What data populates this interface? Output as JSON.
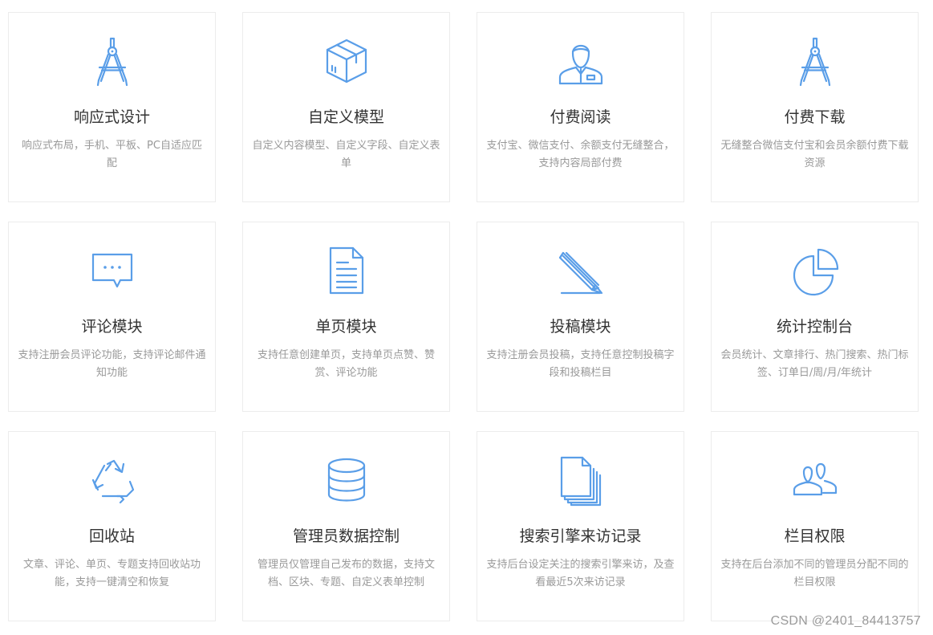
{
  "features": [
    {
      "icon": "compass-icon",
      "title": "响应式设计",
      "desc": "响应式布局，手机、平板、PC自适应匹配"
    },
    {
      "icon": "box-icon",
      "title": "自定义模型",
      "desc": "自定义内容模型、自定义字段、自定义表单"
    },
    {
      "icon": "user-icon",
      "title": "付费阅读",
      "desc": "支付宝、微信支付、余额支付无缝整合，支持内容局部付费"
    },
    {
      "icon": "compass-icon",
      "title": "付费下载",
      "desc": "无缝整合微信支付宝和会员余额付费下载资源"
    },
    {
      "icon": "comment-icon",
      "title": "评论模块",
      "desc": "支持注册会员评论功能，支持评论邮件通知功能"
    },
    {
      "icon": "document-icon",
      "title": "单页模块",
      "desc": "支持任意创建单页，支持单页点赞、赞赏、评论功能"
    },
    {
      "icon": "pencil-icon",
      "title": "投稿模块",
      "desc": "支持注册会员投稿，支持任意控制投稿字段和投稿栏目"
    },
    {
      "icon": "pie-chart-icon",
      "title": "统计控制台",
      "desc": "会员统计、文章排行、热门搜索、热门标签、订单日/周/月/年统计"
    },
    {
      "icon": "recycle-icon",
      "title": "回收站",
      "desc": "文章、评论、单页、专题支持回收站功能，支持一键清空和恢复"
    },
    {
      "icon": "database-icon",
      "title": "管理员数据控制",
      "desc": "管理员仅管理自己发布的数据，支持文档、区块、专题、自定义表单控制"
    },
    {
      "icon": "files-icon",
      "title": "搜索引擎来访记录",
      "desc": "支持后台设定关注的搜索引擎来访，及查看最近5次来访记录"
    },
    {
      "icon": "users-icon",
      "title": "栏目权限",
      "desc": "支持在后台添加不同的管理员分配不同的栏目权限"
    }
  ],
  "watermark": "CSDN @2401_84413757",
  "colors": {
    "icon": "#5a9ee8",
    "title": "#333333",
    "desc": "#999999",
    "border": "#ececec"
  }
}
